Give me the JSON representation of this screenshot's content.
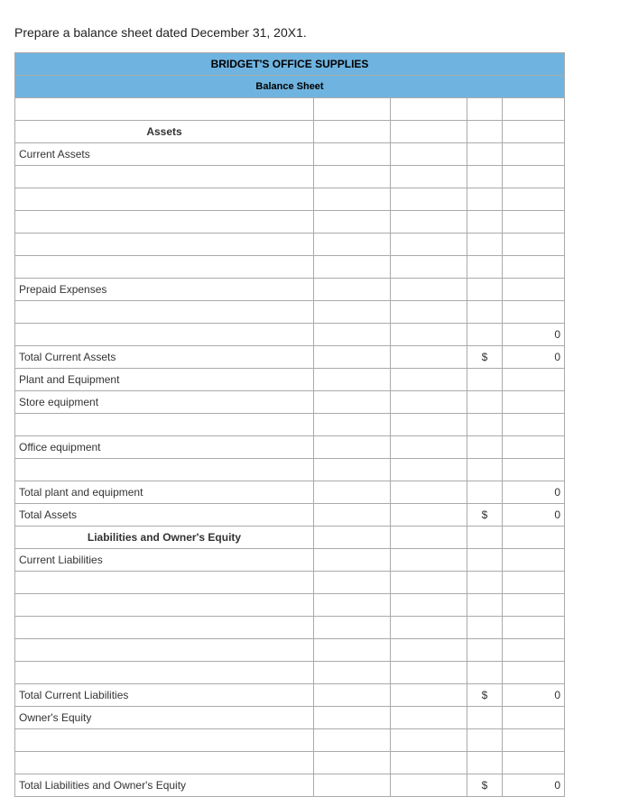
{
  "instruction": "Prepare a balance sheet dated December 31, 20X1.",
  "title": "BRIDGET'S OFFICE SUPPLIES",
  "subtitle": "Balance Sheet",
  "sections": {
    "assets_header": "Assets",
    "current_assets": "Current Assets",
    "prepaid_expenses": "Prepaid Expenses",
    "total_current_assets": "Total Current Assets",
    "plant_and_equipment": "Plant and Equipment",
    "store_equipment": "Store equipment",
    "office_equipment": "Office equipment",
    "total_plant_and_equipment": "Total plant and equipment",
    "total_assets": "Total Assets",
    "liab_equity_header": "Liabilities and Owner's Equity",
    "current_liabilities": "Current Liabilities",
    "total_current_liabilities": "Total Current Liabilities",
    "owners_equity": "Owner's Equity",
    "total_liab_equity": "Total Liabilities and Owner's Equity"
  },
  "currency": "$",
  "values": {
    "prepaid_total": "0",
    "total_current_assets": "0",
    "total_plant_equipment": "0",
    "total_assets": "0",
    "total_current_liabilities": "0",
    "total_liab_equity": "0"
  }
}
